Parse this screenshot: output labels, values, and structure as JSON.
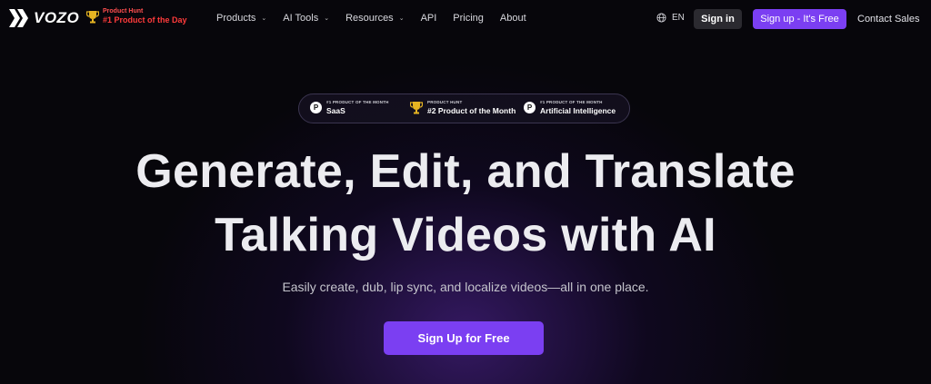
{
  "brand": {
    "name": "VOZO"
  },
  "product_hunt": {
    "label": "Product Hunt",
    "award": "#1 Product of the Day"
  },
  "nav": {
    "items": [
      {
        "label": "Products",
        "dropdown": true
      },
      {
        "label": "AI Tools",
        "dropdown": true
      },
      {
        "label": "Resources",
        "dropdown": true
      },
      {
        "label": "API",
        "dropdown": false
      },
      {
        "label": "Pricing",
        "dropdown": false
      },
      {
        "label": "About",
        "dropdown": false
      }
    ],
    "language": "EN",
    "sign_in": "Sign in",
    "sign_up": "Sign up - It's Free",
    "contact": "Contact Sales"
  },
  "badges": [
    {
      "small": "#1 PRODUCT OF THE MONTH",
      "main": "SaaS",
      "icon": "product-hunt-icon"
    },
    {
      "small": "PRODUCT HUNT",
      "main": "#2 Product of the Month",
      "icon": "trophy-icon"
    },
    {
      "small": "#1 PRODUCT OF THE MONTH",
      "main": "Artificial Intelligence",
      "icon": "product-hunt-icon"
    }
  ],
  "hero": {
    "line1": "Generate, Edit, and Translate",
    "line2": "Talking Videos with AI",
    "subtitle": "Easily create, dub, lip sync, and localize videos—all in one place.",
    "cta": "Sign Up for Free"
  },
  "colors": {
    "accent": "#7b3ff2",
    "background": "#07060b",
    "award_red": "#ff3b3b"
  }
}
